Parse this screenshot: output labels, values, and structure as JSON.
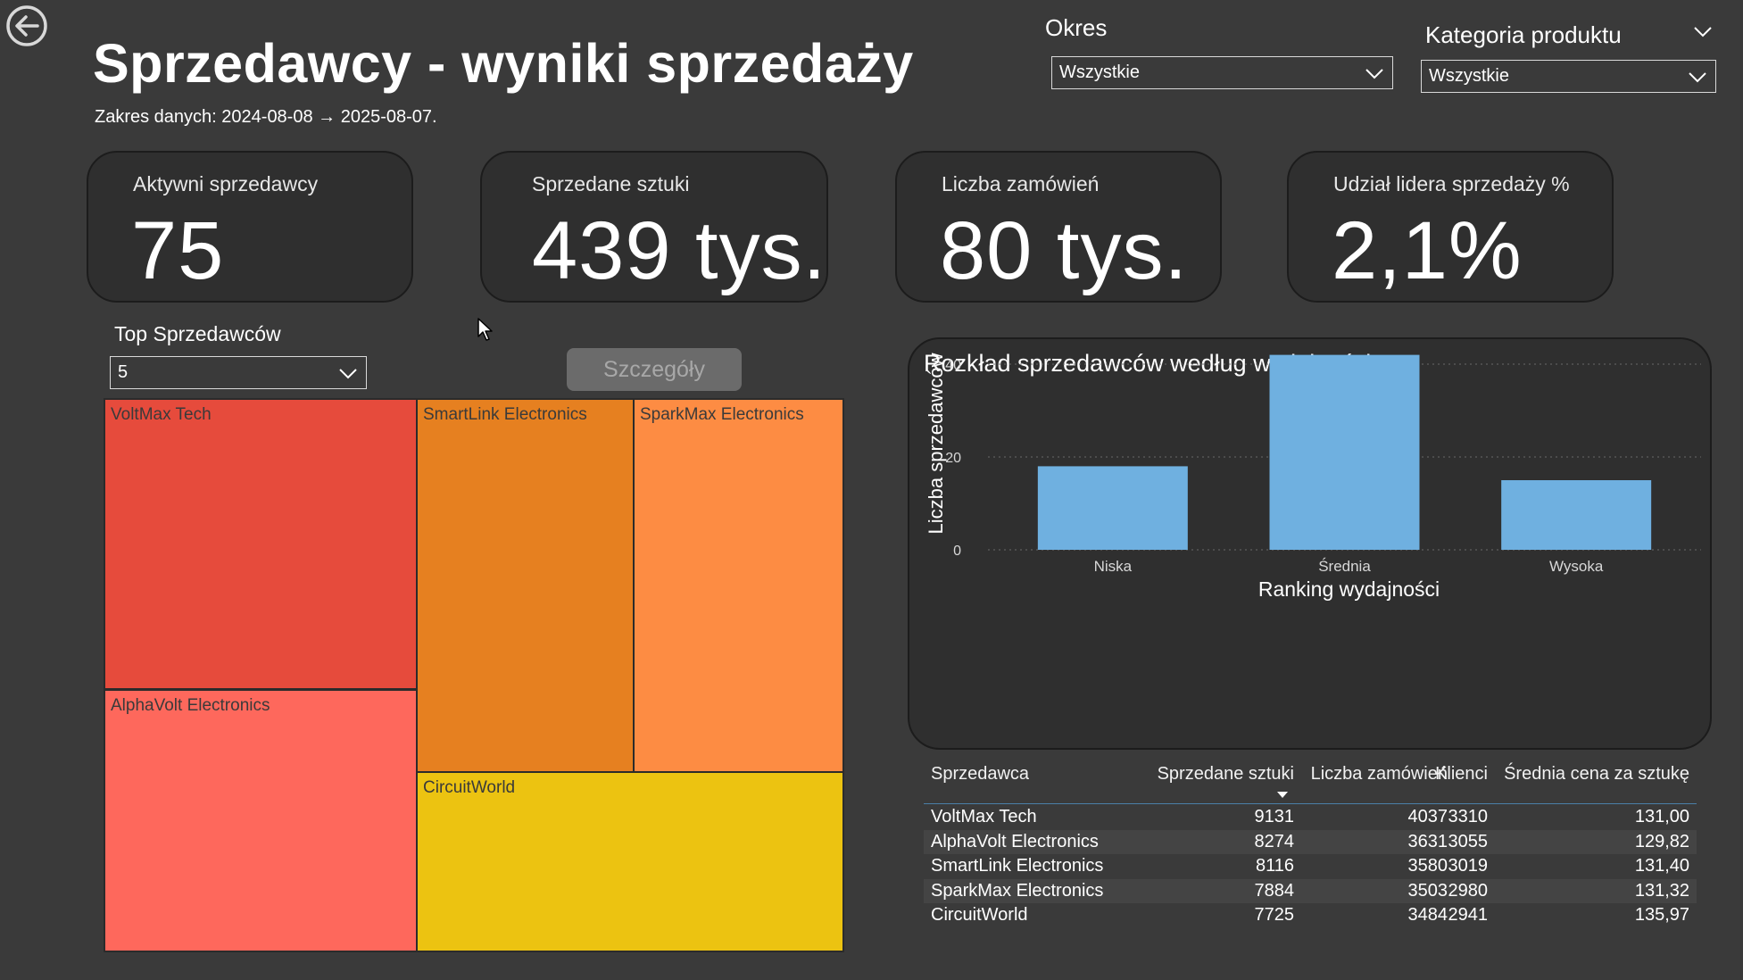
{
  "header": {
    "title": "Sprzedawcy - wyniki sprzedaży",
    "date_range": "Zakres danych: 2024-08-08 → 2025-08-07."
  },
  "slicers": {
    "period": {
      "label": "Okres",
      "value": "Wszystkie"
    },
    "category": {
      "label": "Kategoria produktu",
      "value": "Wszystkie"
    },
    "top_sellers": {
      "label": "Top Sprzedawców",
      "value": "5"
    }
  },
  "kpis": [
    {
      "label": "Aktywni sprzedawcy",
      "value": "75"
    },
    {
      "label": "Sprzedane sztuki",
      "value": "439 tys."
    },
    {
      "label": "Liczba zamówień",
      "value": "80 tys."
    },
    {
      "label": "Udział lidera sprzedaży %",
      "value": "2,1%"
    }
  ],
  "details_button": {
    "label": "Szczegóły"
  },
  "treemap": {
    "tiles": [
      {
        "name": "VoltMax Tech",
        "color": "#e64b3c"
      },
      {
        "name": "AlphaVolt Electronics",
        "color": "#fe685c"
      },
      {
        "name": "SmartLink Electronics",
        "color": "#e68020"
      },
      {
        "name": "SparkMax Electronics",
        "color": "#fd8c43"
      },
      {
        "name": "CircuitWorld",
        "color": "#ecc311"
      }
    ]
  },
  "chart_data": {
    "type": "bar",
    "title": "Rozkład sprzedawców według wydajności",
    "categories": [
      "Niska",
      "Średnia",
      "Wysoka"
    ],
    "values": [
      18,
      42,
      15
    ],
    "xlabel": "Ranking wydajności",
    "ylabel": "Liczba sprzedawców",
    "yticks": [
      "0",
      "20",
      "40"
    ],
    "ylim": [
      0,
      45
    ],
    "grid": true,
    "bar_color": "#6fb0e0"
  },
  "table": {
    "columns": [
      "Sprzedawca",
      "Sprzedane sztuki",
      "Liczba zamówień",
      "Klienci",
      "Średnia cena za sztukę"
    ],
    "sorted_column": "Liczba zamówień",
    "rows": [
      [
        "VoltMax Tech",
        "9131",
        "4037",
        "3310",
        "131,00"
      ],
      [
        "AlphaVolt Electronics",
        "8274",
        "3631",
        "3055",
        "129,82"
      ],
      [
        "SmartLink Electronics",
        "8116",
        "3580",
        "3019",
        "131,40"
      ],
      [
        "SparkMax Electronics",
        "7884",
        "3503",
        "2980",
        "131,32"
      ],
      [
        "CircuitWorld",
        "7725",
        "3484",
        "2941",
        "135,97"
      ]
    ]
  }
}
